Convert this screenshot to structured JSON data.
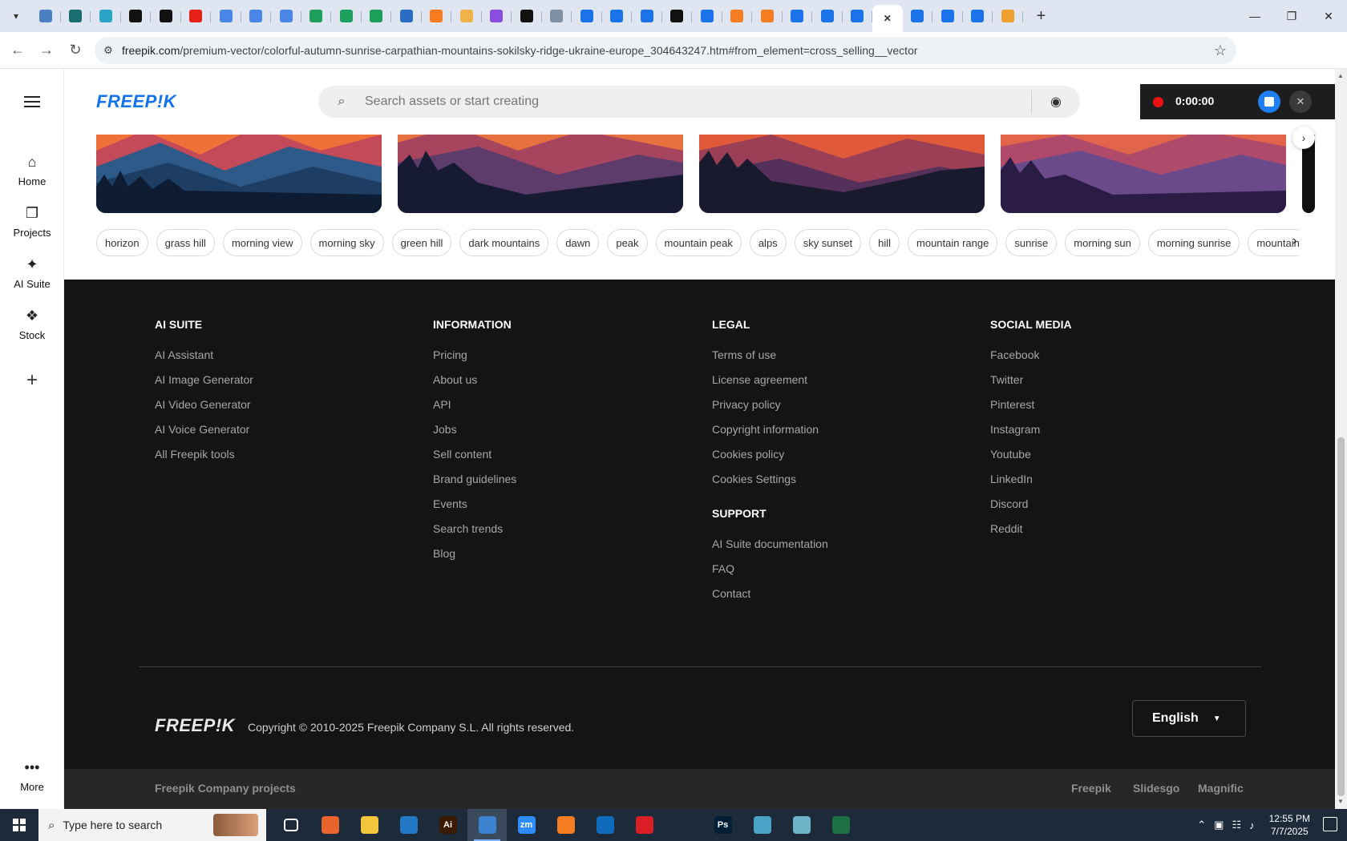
{
  "browser": {
    "url_host": "freepik.com",
    "url_path": "/premium-vector/colorful-autumn-sunrise-carpathian-mountains-sokilsky-ridge-ukraine-europe_304643247.htm#from_element=cross_selling__vector",
    "tabs": [
      {
        "icon": "globe-icon",
        "color": "#4a7fc1"
      },
      {
        "icon": "vpn-icon",
        "color": "#1a6e70"
      },
      {
        "icon": "arrow-icon",
        "color": "#2aa3c7"
      },
      {
        "icon": "openai-icon",
        "color": "#111111"
      },
      {
        "icon": "bolt-icon",
        "color": "#111111"
      },
      {
        "icon": "youtube-icon",
        "color": "#e62117"
      },
      {
        "icon": "docs-icon",
        "color": "#4a86e8"
      },
      {
        "icon": "docs-icon",
        "color": "#4a86e8"
      },
      {
        "icon": "docs-icon",
        "color": "#4a86e8"
      },
      {
        "icon": "sheets-icon",
        "color": "#1e9e5b"
      },
      {
        "icon": "sheets-icon",
        "color": "#1e9e5b"
      },
      {
        "icon": "sheets-icon",
        "color": "#1e9e5b"
      },
      {
        "icon": "word-icon",
        "color": "#2b6cc4"
      },
      {
        "icon": "xampp-icon",
        "color": "#f57c20"
      },
      {
        "icon": "cat-icon",
        "color": "#f0b34a"
      },
      {
        "icon": "brackets-icon",
        "color": "#8a4de0"
      },
      {
        "icon": "lambda-icon",
        "color": "#111111"
      },
      {
        "icon": "apps-icon",
        "color": "#7f8ea3"
      },
      {
        "icon": "forms-icon",
        "color": "#1a73e8"
      },
      {
        "icon": "forms-icon",
        "color": "#1a73e8"
      },
      {
        "icon": "forms-icon",
        "color": "#1a73e8"
      },
      {
        "icon": "m-icon",
        "color": "#111111"
      },
      {
        "icon": "forms-icon",
        "color": "#1a73e8"
      },
      {
        "icon": "xampp-icon",
        "color": "#f57c20"
      },
      {
        "icon": "xampp-icon",
        "color": "#f57c20"
      },
      {
        "icon": "forms-icon",
        "color": "#1a73e8"
      },
      {
        "icon": "forms-icon",
        "color": "#1a73e8"
      },
      {
        "icon": "forms-icon",
        "color": "#1a73e8"
      },
      {
        "icon": "close-icon",
        "color": "#333333",
        "active": true
      },
      {
        "icon": "forms-icon",
        "color": "#1a73e8"
      },
      {
        "icon": "forms-icon",
        "color": "#1a73e8"
      },
      {
        "icon": "forms-icon",
        "color": "#1a73e8"
      },
      {
        "icon": "hand-icon",
        "color": "#f0a030"
      }
    ]
  },
  "sidebar": {
    "items": [
      {
        "label": "Home",
        "icon": "home-icon"
      },
      {
        "label": "Projects",
        "icon": "projects-icon"
      },
      {
        "label": "AI Suite",
        "icon": "sparkle-icon"
      },
      {
        "label": "Stock",
        "icon": "stock-icon"
      }
    ],
    "more": "More"
  },
  "header": {
    "logo": "FREEP!K",
    "search_placeholder": "Search assets or start creating"
  },
  "recorder": {
    "time": "0:00:00"
  },
  "tags": [
    "horizon",
    "grass hill",
    "morning view",
    "morning sky",
    "green hill",
    "dark mountains",
    "dawn",
    "peak",
    "mountain peak",
    "alps",
    "sky sunset",
    "hill",
    "mountain range",
    "sunrise",
    "morning sun",
    "morning sunrise",
    "mountain"
  ],
  "footer": {
    "ai_suite": {
      "title": "AI SUITE",
      "links": [
        "AI Assistant",
        "AI Image Generator",
        "AI Video Generator",
        "AI Voice Generator",
        "All Freepik tools"
      ]
    },
    "information": {
      "title": "INFORMATION",
      "links": [
        "Pricing",
        "About us",
        "API",
        "Jobs",
        "Sell content",
        "Brand guidelines",
        "Events",
        "Search trends",
        "Blog"
      ]
    },
    "legal": {
      "title": "LEGAL",
      "links": [
        "Terms of use",
        "License agreement",
        "Privacy policy",
        "Copyright information",
        "Cookies policy",
        "Cookies Settings"
      ]
    },
    "support": {
      "title": "SUPPORT",
      "links": [
        "AI Suite documentation",
        "FAQ",
        "Contact"
      ]
    },
    "social": {
      "title": "SOCIAL MEDIA",
      "links": [
        "Facebook",
        "Twitter",
        "Pinterest",
        "Instagram",
        "Youtube",
        "LinkedIn",
        "Discord",
        "Reddit"
      ]
    },
    "logo": "FREEP!K",
    "copyright": "Copyright © 2010-2025 Freepik Company S.L. All rights reserved.",
    "language": "English"
  },
  "projects": {
    "label": "Freepik Company projects",
    "items": [
      "Freepik",
      "Slidesgo",
      "Magnific"
    ]
  },
  "taskbar": {
    "search_placeholder": "Type here to search",
    "time": "12:55 PM",
    "date": "7/7/2025",
    "apps": [
      {
        "icon": "task-view-icon",
        "color": "#1c2a3a",
        "label": ""
      },
      {
        "icon": "firefox-icon",
        "color": "#e8642c",
        "label": ""
      },
      {
        "icon": "file-explorer-icon",
        "color": "#f2c53d",
        "label": ""
      },
      {
        "icon": "vscode-icon",
        "color": "#2479c7",
        "label": ""
      },
      {
        "icon": "illustrator-icon",
        "color": "#3a1a00",
        "label": "Ai"
      },
      {
        "icon": "chrome-icon",
        "color": "#3b82d1",
        "label": "",
        "active": true
      },
      {
        "icon": "zoom-icon",
        "color": "#2d8cff",
        "label": "zm"
      },
      {
        "icon": "xampp-icon",
        "color": "#f57c20",
        "label": ""
      },
      {
        "icon": "outlook-icon",
        "color": "#0f6cbd",
        "label": ""
      },
      {
        "icon": "creative-cloud-icon",
        "color": "#da1f26",
        "label": ""
      },
      {
        "icon": "pen-icon",
        "color": "#1c2a3a",
        "label": ""
      },
      {
        "icon": "photoshop-icon",
        "color": "#001e36",
        "label": "Ps"
      },
      {
        "icon": "app-icon",
        "color": "#4aa3c7",
        "label": ""
      },
      {
        "icon": "notepad-icon",
        "color": "#6fb3c9",
        "label": ""
      },
      {
        "icon": "excel-icon",
        "color": "#1d7044",
        "label": ""
      }
    ]
  }
}
